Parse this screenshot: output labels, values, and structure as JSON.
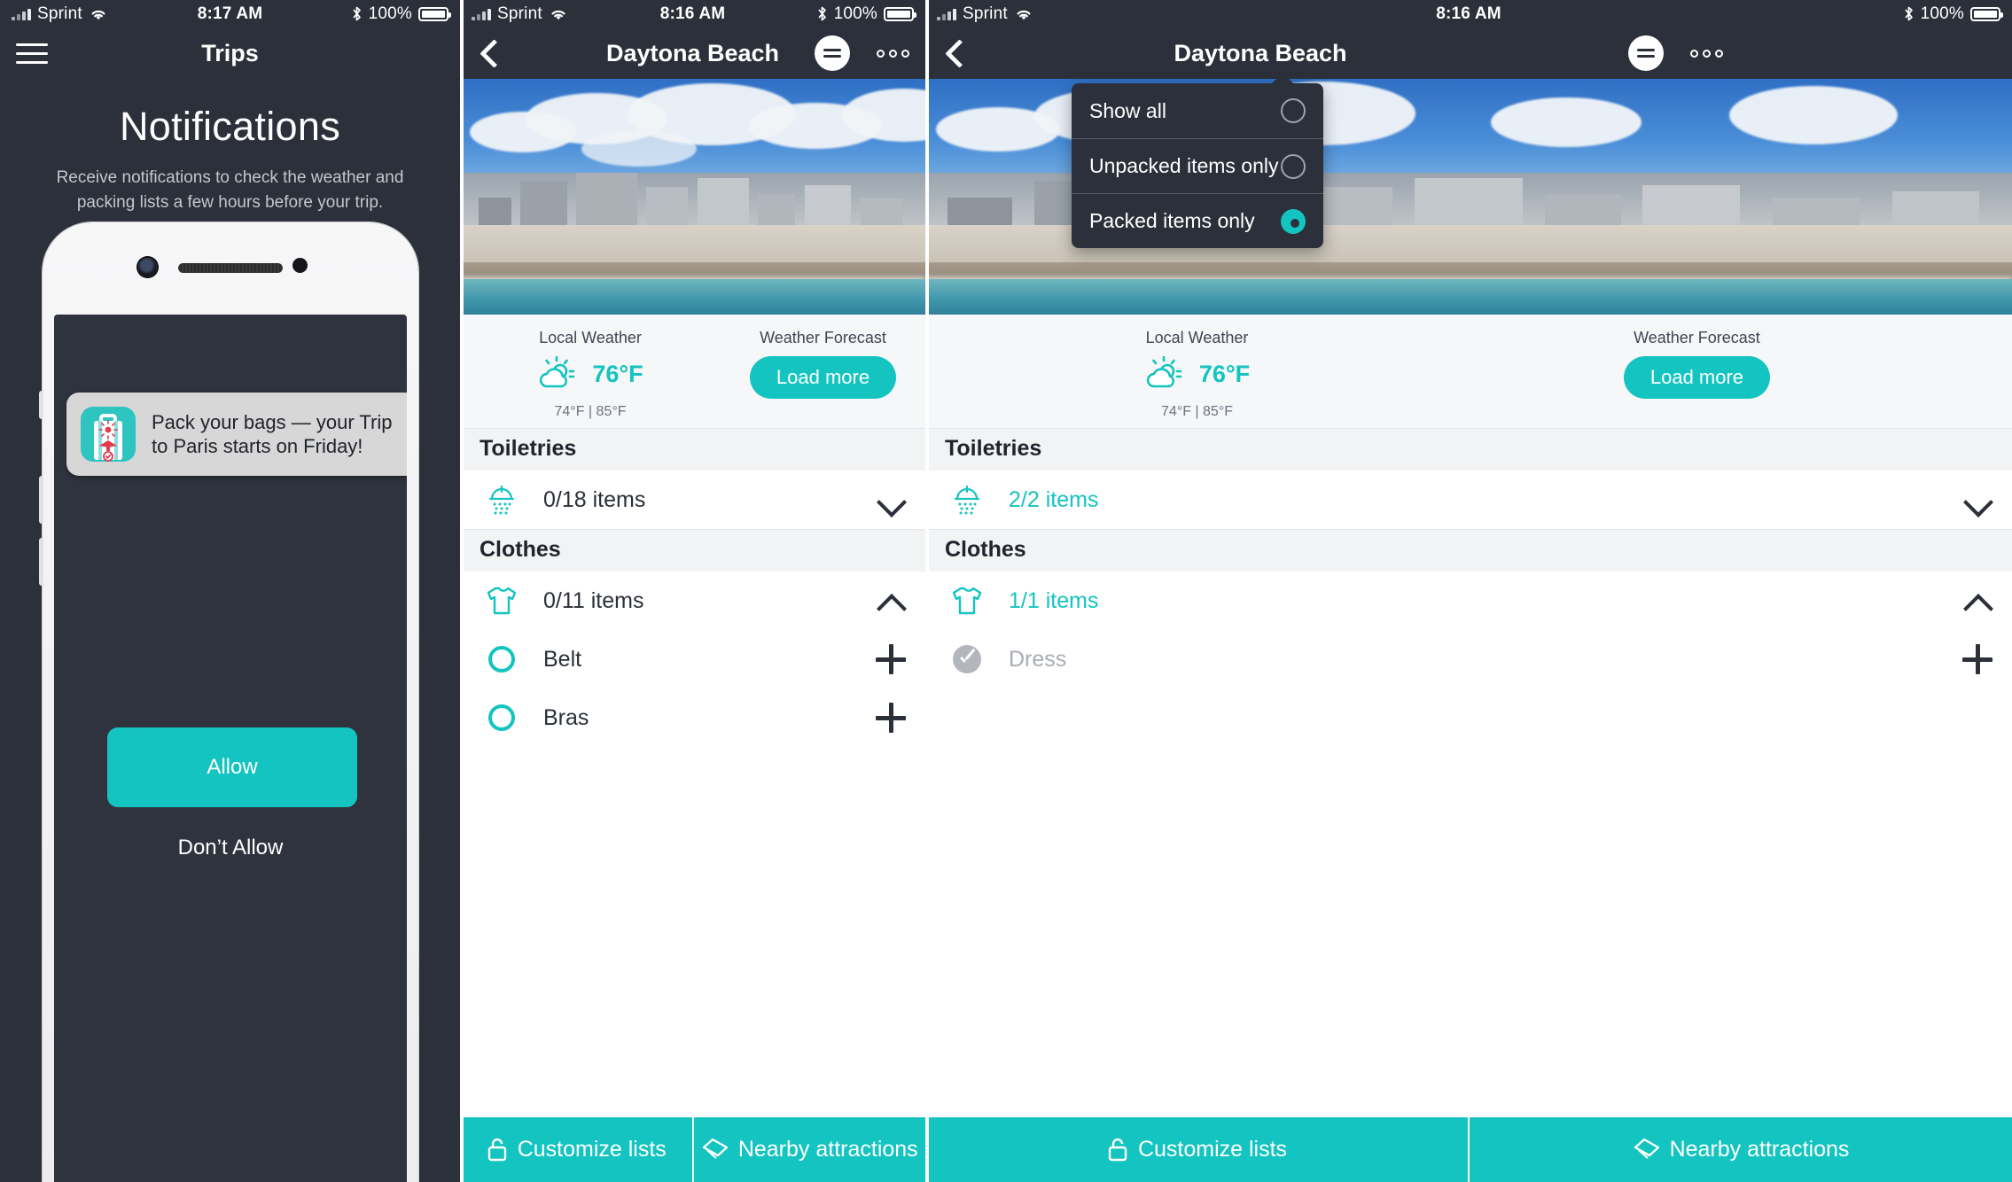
{
  "theme": {
    "accent": "#14c4c0",
    "dark": "#2b303a",
    "muted": "#a8adb5"
  },
  "panel1": {
    "status": {
      "carrier": "Sprint",
      "wifi_icon": "wifi-icon",
      "time": "8:17 AM",
      "bluetooth_icon": "bluetooth-icon",
      "battery_pct": "100%",
      "battery_icon": "battery-icon"
    },
    "nav": {
      "menu_icon": "hamburger-icon",
      "title": "Trips"
    },
    "heading": "Notifications",
    "subtext": "Receive notifications to check the weather and packing lists a few hours before your trip.",
    "toast": {
      "app_icon": "suitcase-app-icon",
      "message": "Pack your bags — your Trip to Paris starts on Friday!"
    },
    "allow_label": "Allow",
    "deny_label": "Don’t Allow"
  },
  "panel2": {
    "status": {
      "carrier": "Sprint",
      "wifi_icon": "wifi-icon",
      "time": "8:16 AM",
      "bluetooth_icon": "bluetooth-icon",
      "battery_pct": "100%",
      "battery_icon": "battery-icon"
    },
    "nav": {
      "back_icon": "back-chevron-icon",
      "title": "Daytona Beach",
      "filter_icon": "filter-lines-icon",
      "more_icon": "more-dots-icon"
    },
    "hero_alt": "daytona-beach-photo",
    "weather": {
      "local_label": "Local Weather",
      "forecast_label": "Weather Forecast",
      "icon": "sun-cloud-icon",
      "temp": "76°F",
      "range": "74°F | 85°F",
      "load_more": "Load more"
    },
    "sections": [
      {
        "title": "Toiletries",
        "icon": "shower-icon",
        "count": "0/18 items",
        "expanded": false,
        "chevron": "chevron-down-icon",
        "items": []
      },
      {
        "title": "Clothes",
        "icon": "tshirt-icon",
        "count": "0/11 items",
        "expanded": true,
        "chevron": "chevron-up-icon",
        "items": [
          {
            "name": "Belt",
            "packed": false,
            "check_icon": "circle-unchecked-icon",
            "add_icon": "plus-icon"
          },
          {
            "name": "Bras",
            "packed": false,
            "check_icon": "circle-unchecked-icon",
            "add_icon": "plus-icon"
          }
        ]
      }
    ],
    "bottom": [
      {
        "label": "Customize lists",
        "icon": "lock-icon"
      },
      {
        "label": "Nearby attractions",
        "icon": "ticket-icon"
      }
    ]
  },
  "panel3": {
    "status": {
      "carrier": "Sprint",
      "wifi_icon": "wifi-icon",
      "time": "8:16 AM",
      "bluetooth_icon": "bluetooth-icon",
      "battery_pct": "100%",
      "battery_icon": "battery-icon"
    },
    "nav": {
      "back_icon": "back-chevron-icon",
      "title": "Daytona Beach",
      "filter_icon": "filter-lines-icon",
      "more_icon": "more-dots-icon"
    },
    "dropdown": {
      "options": [
        {
          "label": "Show all",
          "selected": false
        },
        {
          "label": "Unpacked items only",
          "selected": false
        },
        {
          "label": "Packed items only",
          "selected": true
        }
      ]
    },
    "weather": {
      "local_label": "Local Weather",
      "forecast_label": "Weather Forecast",
      "icon": "sun-cloud-icon",
      "temp": "76°F",
      "range": "74°F | 85°F",
      "load_more": "Load more"
    },
    "sections": [
      {
        "title": "Toiletries",
        "icon": "shower-icon",
        "count": "2/2 items",
        "expanded": false,
        "chevron": "chevron-down-icon",
        "items": []
      },
      {
        "title": "Clothes",
        "icon": "tshirt-icon",
        "count": "1/1 items",
        "expanded": true,
        "chevron": "chevron-up-icon",
        "items": [
          {
            "name": "Dress",
            "packed": true,
            "check_icon": "circle-checked-icon",
            "add_icon": "plus-icon"
          }
        ]
      }
    ],
    "bottom": [
      {
        "label": "Customize lists",
        "icon": "lock-icon"
      },
      {
        "label": "Nearby attractions",
        "icon": "ticket-icon"
      }
    ]
  }
}
